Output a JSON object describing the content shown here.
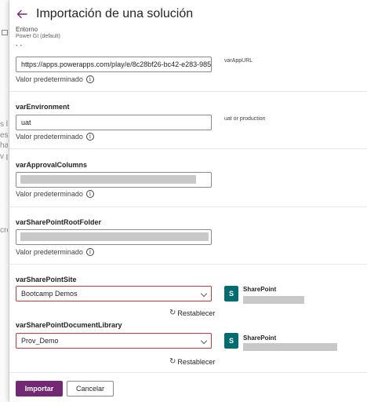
{
  "background_fragments": [
    "s la",
    "es e",
    "ha",
    "v pl",
    "cre"
  ],
  "panel": {
    "title": "Importación de una solución",
    "environment_label": "Entorno",
    "environment_value": "Power GI (default)"
  },
  "fields": [
    {
      "name": "varAppURL",
      "value": "https://apps.powerapps.com/play/e/8c28bf26-bc42-e283-985...",
      "side_note": "varAppURL",
      "default_label": "Valor predeterminado"
    },
    {
      "name": "varEnvironment",
      "value": "uat",
      "side_note": "uat or production",
      "default_label": "Valor predeterminado"
    },
    {
      "name": "varApprovalColumns",
      "value": "",
      "default_label": "Valor predeterminado"
    },
    {
      "name": "varSharePointRootFolder",
      "value": "",
      "default_label": "Valor predeterminado"
    }
  ],
  "connections": [
    {
      "name": "varSharePointSite",
      "selected": "Bootcamp Demos",
      "refresh_label": "Restablecer",
      "connector_name": "SharePoint",
      "connector_logo": "S"
    },
    {
      "name": "varSharePointDocumentLibrary",
      "selected": "Prov_Demo",
      "refresh_label": "Restablecer",
      "connector_name": "SharePoint",
      "connector_logo": "S"
    }
  ],
  "footer": {
    "import_label": "Importar",
    "cancel_label": "Cancelar"
  },
  "icons": {
    "back": "back-arrow-icon",
    "info": "info-icon",
    "refresh": "refresh-icon",
    "chevron": "chevron-down-icon"
  },
  "colors": {
    "primary": "#742774",
    "error_border": "#d13438",
    "sharepoint": "#036c70"
  }
}
